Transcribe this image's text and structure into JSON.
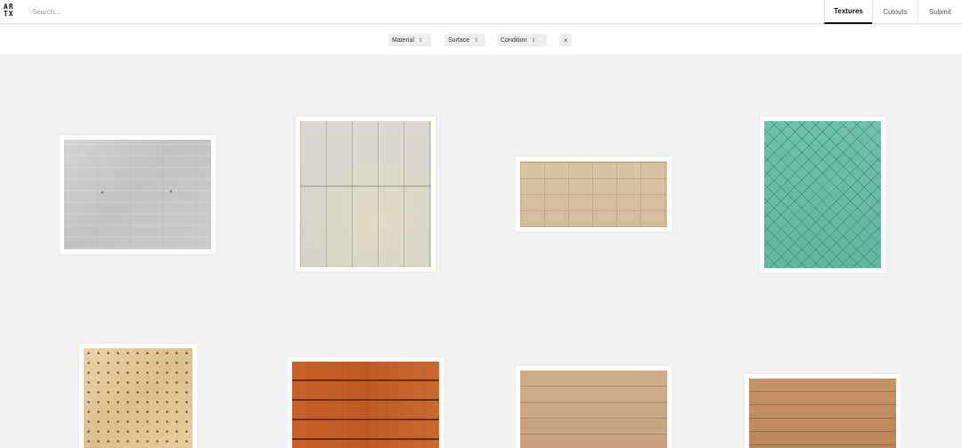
{
  "header": {
    "logo_line1": "AR",
    "logo_line2": "TX",
    "search_placeholder": "Search...",
    "nav": [
      {
        "label": "Textures",
        "active": true
      },
      {
        "label": "Cutouts",
        "active": false
      },
      {
        "label": "Submit",
        "active": false
      }
    ]
  },
  "filters": {
    "items": [
      {
        "label": "Material"
      },
      {
        "label": "Surface"
      },
      {
        "label": "Condition"
      }
    ],
    "clear_label": "×"
  },
  "icons": {
    "sort": "sort-caret-icon",
    "clear": "close-icon"
  },
  "textures": [
    {
      "name": "grey board-formed concrete",
      "color": "#c9c9c9"
    },
    {
      "name": "pale stone slabs",
      "color": "#d6d5ca"
    },
    {
      "name": "beige stone tiles",
      "color": "#d6c09f"
    },
    {
      "name": "green scale tiles",
      "color": "#68bca4"
    },
    {
      "name": "perforated wood panel",
      "color": "#e2c795"
    },
    {
      "name": "orange wood planks",
      "color": "#c45e27"
    },
    {
      "name": "light wood planks",
      "color": "#caa784"
    },
    {
      "name": "tan wood siding",
      "color": "#bf8d60"
    }
  ]
}
